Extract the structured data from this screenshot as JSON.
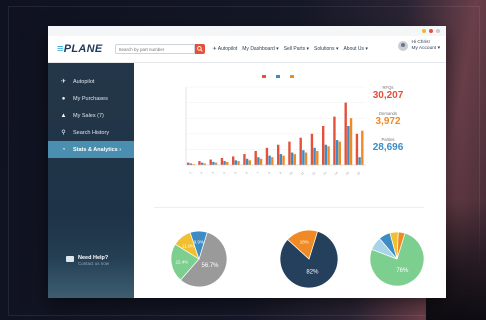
{
  "app": {
    "logo": "PLANE",
    "search_placeholder": "Search by part number",
    "nav": [
      "✈ Autopilot",
      "My Dashboard ▾",
      "Sell Parts ▾",
      "Solutions ▾",
      "About Us ▾"
    ],
    "user_greeting": "Hi Chris!",
    "user_account": "My Account ▾"
  },
  "sidebar": {
    "items": [
      {
        "icon": "✈",
        "label": "Autopilot"
      },
      {
        "icon": "●",
        "label": "My Purchases"
      },
      {
        "icon": "▲",
        "label": "My Sales (7)"
      },
      {
        "icon": "⚲",
        "label": "Search History"
      },
      {
        "icon": "◔",
        "label": "Stats & Analytics ›"
      }
    ],
    "help_title": "Need Help?",
    "help_subtitle": "Contact us now"
  },
  "stats": [
    {
      "label": "RFQs",
      "value": "30,207",
      "color": "#e4503a"
    },
    {
      "label": "Demands",
      "value": "3,972",
      "color": "#f08a24"
    },
    {
      "label": "Parties",
      "value": "28,696",
      "color": "#3d8cc4"
    }
  ],
  "colors": {
    "red": "#e4503a",
    "orange": "#f08a24",
    "blue": "#3d8cc4",
    "navy": "#24405c",
    "green": "#7dcf8f",
    "gray": "#9a9a9a"
  },
  "chart_data": [
    {
      "type": "bar",
      "categories": [
        "1",
        "2",
        "3",
        "4",
        "5",
        "6",
        "7",
        "8",
        "9",
        "10",
        "11",
        "12",
        "13",
        "14",
        "15",
        "16"
      ],
      "series": [
        {
          "values": [
            3,
            5,
            7,
            9,
            11,
            14,
            18,
            22,
            26,
            30,
            35,
            40,
            50,
            62,
            80,
            40
          ]
        },
        {
          "values": [
            2,
            3,
            4,
            5,
            6,
            8,
            10,
            12,
            14,
            16,
            19,
            22,
            26,
            32,
            50,
            10
          ]
        },
        {
          "values": [
            1,
            2,
            3,
            4,
            5,
            6,
            8,
            10,
            12,
            14,
            16,
            18,
            24,
            30,
            60,
            44
          ]
        }
      ],
      "ylim": [
        0,
        100
      ]
    },
    {
      "type": "pie",
      "labels": [
        "56.7%",
        "22.4%",
        "11.0%",
        "9.9%"
      ],
      "values": [
        56.7,
        22.4,
        11.0,
        9.9
      ],
      "colors": [
        "#9a9a9a",
        "#7dcf8f",
        "#f0c030",
        "#3d8cc4"
      ]
    },
    {
      "type": "pie",
      "labels": [
        "82%",
        "18%"
      ],
      "values": [
        82,
        18
      ],
      "colors": [
        "#24405c",
        "#f08a24"
      ]
    },
    {
      "type": "pie",
      "labels": [
        "76%",
        "",
        "",
        "",
        ""
      ],
      "values": [
        76,
        8,
        7,
        5,
        4
      ],
      "colors": [
        "#7dcf8f",
        "#a8d4e8",
        "#3d8cc4",
        "#f0c030",
        "#f08a24"
      ]
    }
  ]
}
